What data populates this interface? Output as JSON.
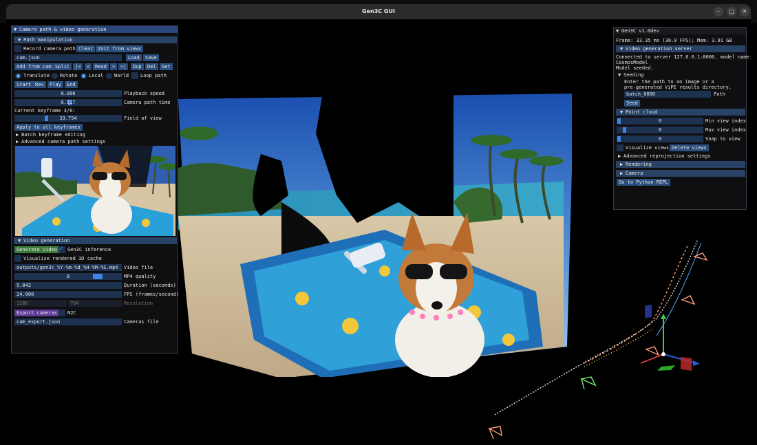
{
  "window": {
    "title": "Gen3C GUI",
    "controls": {
      "minimize": "–",
      "maximize": "□",
      "close": "✕"
    }
  },
  "left_panel": {
    "title": "Camera path & video generation",
    "path_header": "Path manipulation",
    "record_label": "Record camera path",
    "clear_btn": "Clear",
    "init_btn": "Init from views",
    "path_file": "cam.json",
    "load_btn": "Load",
    "save_btn": "Save",
    "row_buttons": {
      "add": "Add from cam",
      "split": "Split",
      "first": "|<",
      "prev": "<",
      "read": "Read",
      "next": ">",
      "last": ">|",
      "dup": "Dup",
      "del": "Del",
      "set": "Set"
    },
    "modes": {
      "translate": "Translate",
      "rotate": "Rotate",
      "local": "Local",
      "world": "World",
      "loop": "Loop path"
    },
    "transport": {
      "start": "Start",
      "rev": "Rev",
      "play": "Play",
      "end": "End"
    },
    "playback_value": "0.000",
    "playback_label": "Playback speed",
    "time_value": "0.517",
    "time_label": "Camera path time",
    "time_fraction": 0.517,
    "keyframe_text": "Current keyframe 3/6:",
    "fov_value": "33.754",
    "fov_label": "Field of view",
    "fov_fraction": 0.29,
    "apply_btn": "Apply to all keyframes",
    "batch_label": "Batch keyframe editing",
    "advanced_label": "Advanced camera path settings",
    "video_header": "Video generation",
    "generate_btn": "Generate video",
    "inference_label": "Gen3C inference",
    "visualize_cache_label": "Visualize rendered 3D cache",
    "video_file_value": "outputs/gen3c_%Y-%m-%d_%H-%M-%S.mp4",
    "video_file_label": "Video file",
    "quality_value": "8",
    "quality_label": "MP4 quality",
    "quality_fraction": 0.8,
    "duration_value": "5.042",
    "duration_label": "Duration (seconds)",
    "fps_value": "24.000",
    "fps_label": "FPS (frames/second)",
    "res_w": "1280",
    "res_h": "704",
    "res_label": "Resolution",
    "export_btn": "Export cameras",
    "n2c_label": "N2C",
    "cameras_file_value": "cam_export.json",
    "cameras_file_label": "Cameras file"
  },
  "right_panel": {
    "title": "Gen3C v1.0dev",
    "stats": "Frame: 33.35 ms (30.0 FPS); Mem: 3.91 GB",
    "server_header": "Video generation server",
    "server_line1": "Connected to server 127.0.0.1:8000, model name:",
    "server_line2": "CosmosModel",
    "server_line3": "Model seeded.",
    "seeding_label": "Seeding",
    "seeding_text1": "Enter the path to an image or a",
    "seeding_text2": "pre-generated ViPE results directory.",
    "path_value": "batch_0000",
    "path_label": "Path",
    "seed_btn": "Seed",
    "point_cloud_header": "Point cloud",
    "min_view_value": "0",
    "min_view_label": "Min view index",
    "max_view_value": "0",
    "max_view_label": "Max view index",
    "snap_value": "0",
    "snap_label": "Snap to view",
    "visualize_views_label": "Visualize views",
    "delete_views_btn": "Delete views",
    "advanced_reproj_label": "Advanced reprojection settings",
    "rendering_header": "Rendering",
    "camera_header": "Camera",
    "python_btn": "Go to Python REPL"
  },
  "colors": {
    "title_active": "#29477a",
    "header": "#284366",
    "button": "#2a4e7e",
    "frame_bg": "#1d3150",
    "accent": "#3d85e0",
    "generate": "#3d7a3d",
    "export": "#5c3c96"
  }
}
